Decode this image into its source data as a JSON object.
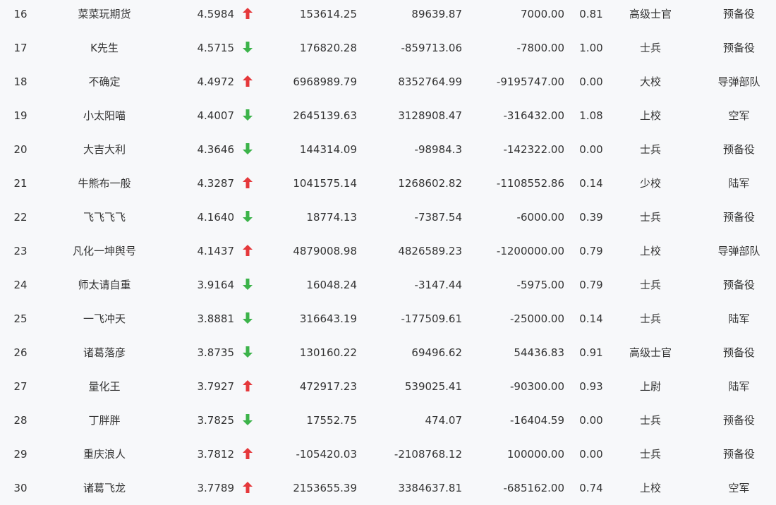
{
  "colors": {
    "up": "#e5383b",
    "down": "#3cb34a",
    "text": "#333333",
    "background": "#f7f8fa"
  },
  "rows": [
    {
      "rank": "16",
      "name": "菜菜玩期货",
      "score": "4.5984",
      "trend": "up",
      "v1": "153614.25",
      "v2": "89639.87",
      "v3": "7000.00",
      "ratio": "0.81",
      "title": "高级士官",
      "unit": "预备役"
    },
    {
      "rank": "17",
      "name": "K先生",
      "score": "4.5715",
      "trend": "down",
      "v1": "176820.28",
      "v2": "-859713.06",
      "v3": "-7800.00",
      "ratio": "1.00",
      "title": "士兵",
      "unit": "预备役"
    },
    {
      "rank": "18",
      "name": "不确定",
      "score": "4.4972",
      "trend": "up",
      "v1": "6968989.79",
      "v2": "8352764.99",
      "v3": "-9195747.00",
      "ratio": "0.00",
      "title": "大校",
      "unit": "导弹部队"
    },
    {
      "rank": "19",
      "name": "小太阳喵",
      "score": "4.4007",
      "trend": "down",
      "v1": "2645139.63",
      "v2": "3128908.47",
      "v3": "-316432.00",
      "ratio": "1.08",
      "title": "上校",
      "unit": "空军"
    },
    {
      "rank": "20",
      "name": "大吉大利",
      "score": "4.3646",
      "trend": "down",
      "v1": "144314.09",
      "v2": "-98984.3",
      "v3": "-142322.00",
      "ratio": "0.00",
      "title": "士兵",
      "unit": "预备役"
    },
    {
      "rank": "21",
      "name": "牛熊布一般",
      "score": "4.3287",
      "trend": "up",
      "v1": "1041575.14",
      "v2": "1268602.82",
      "v3": "-1108552.86",
      "ratio": "0.14",
      "title": "少校",
      "unit": "陆军"
    },
    {
      "rank": "22",
      "name": "飞飞飞飞",
      "score": "4.1640",
      "trend": "down",
      "v1": "18774.13",
      "v2": "-7387.54",
      "v3": "-6000.00",
      "ratio": "0.39",
      "title": "士兵",
      "unit": "预备役"
    },
    {
      "rank": "23",
      "name": "凡化一坤舆号",
      "score": "4.1437",
      "trend": "up",
      "v1": "4879008.98",
      "v2": "4826589.23",
      "v3": "-1200000.00",
      "ratio": "0.79",
      "title": "上校",
      "unit": "导弹部队"
    },
    {
      "rank": "24",
      "name": "师太请自重",
      "score": "3.9164",
      "trend": "down",
      "v1": "16048.24",
      "v2": "-3147.44",
      "v3": "-5975.00",
      "ratio": "0.79",
      "title": "士兵",
      "unit": "预备役"
    },
    {
      "rank": "25",
      "name": "一飞冲天",
      "score": "3.8881",
      "trend": "down",
      "v1": "316643.19",
      "v2": "-177509.61",
      "v3": "-25000.00",
      "ratio": "0.14",
      "title": "士兵",
      "unit": "陆军"
    },
    {
      "rank": "26",
      "name": "诸葛落彦",
      "score": "3.8735",
      "trend": "down",
      "v1": "130160.22",
      "v2": "69496.62",
      "v3": "54436.83",
      "ratio": "0.91",
      "title": "高级士官",
      "unit": "预备役"
    },
    {
      "rank": "27",
      "name": "量化王",
      "score": "3.7927",
      "trend": "up",
      "v1": "472917.23",
      "v2": "539025.41",
      "v3": "-90300.00",
      "ratio": "0.93",
      "title": "上尉",
      "unit": "陆军"
    },
    {
      "rank": "28",
      "name": "丁胖胖",
      "score": "3.7825",
      "trend": "down",
      "v1": "17552.75",
      "v2": "474.07",
      "v3": "-16404.59",
      "ratio": "0.00",
      "title": "士兵",
      "unit": "预备役"
    },
    {
      "rank": "29",
      "name": "重庆浪人",
      "score": "3.7812",
      "trend": "up",
      "v1": "-105420.03",
      "v2": "-2108768.12",
      "v3": "100000.00",
      "ratio": "0.00",
      "title": "士兵",
      "unit": "预备役"
    },
    {
      "rank": "30",
      "name": "诸葛飞龙",
      "score": "3.7789",
      "trend": "up",
      "v1": "2153655.39",
      "v2": "3384637.81",
      "v3": "-685162.00",
      "ratio": "0.74",
      "title": "上校",
      "unit": "空军"
    }
  ]
}
